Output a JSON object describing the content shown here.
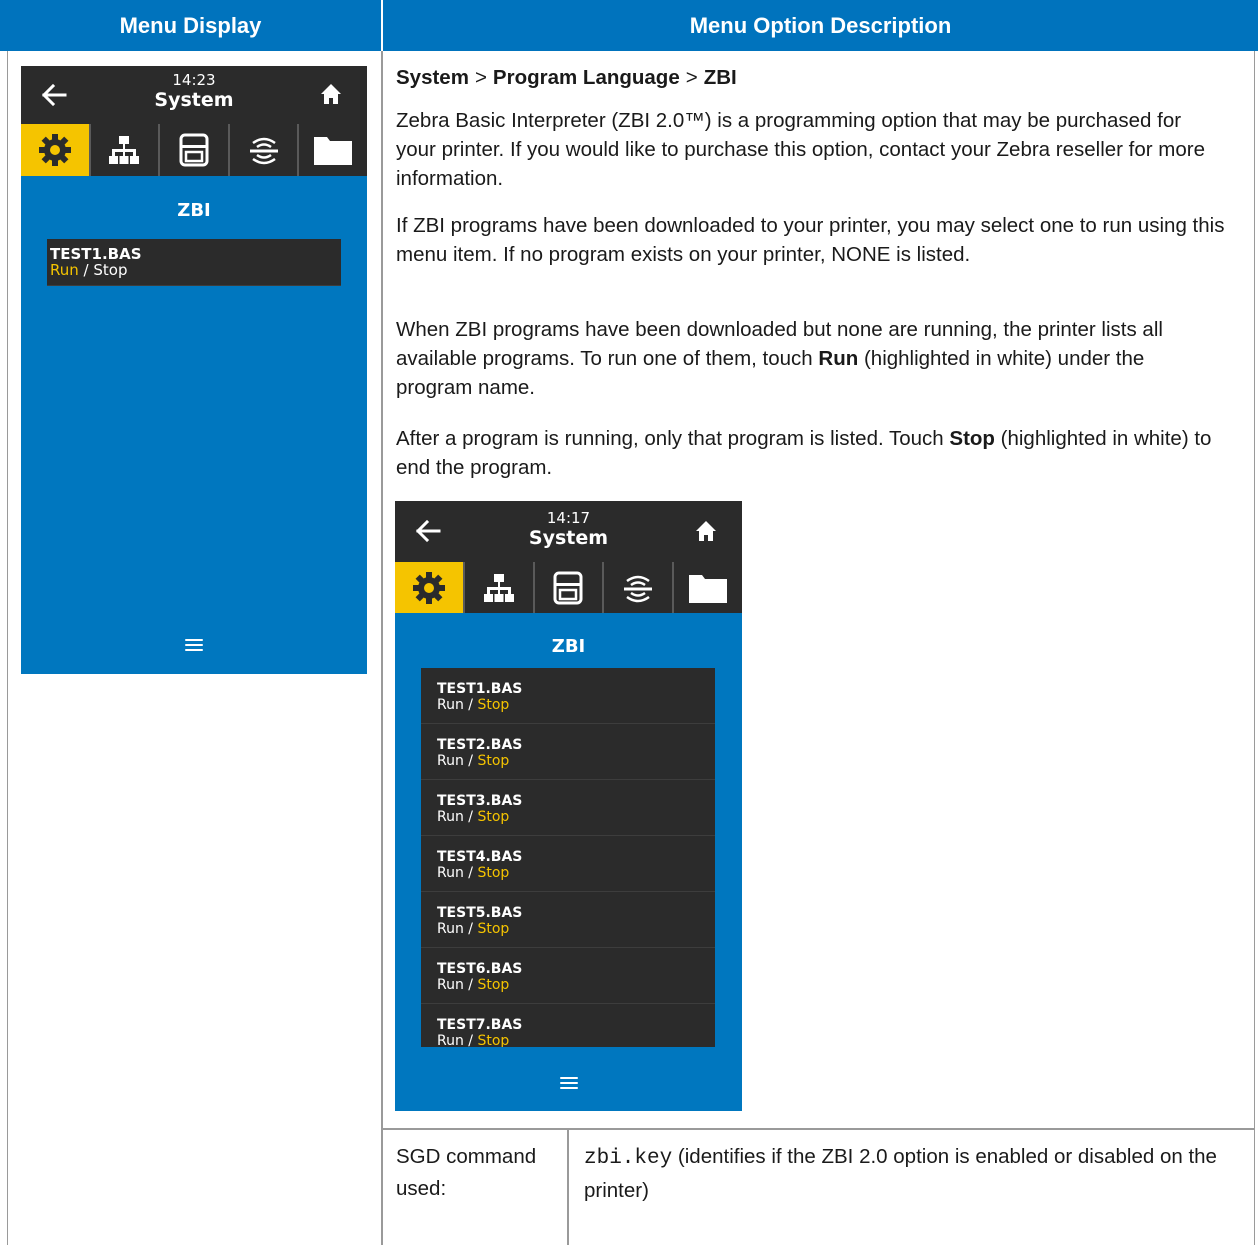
{
  "header": {
    "col1": "Menu Display",
    "col2": "Menu Option Description"
  },
  "breadcrumb": {
    "part1": "System",
    "sep1": ">",
    "part2": "Program Language",
    "sep2": ">",
    "part3": "ZBI"
  },
  "paragraphs": {
    "p1": "Zebra Basic Interpreter (ZBI 2.0™) is a programming option that may be purchased for your printer. If you would like to purchase this option, contact your Zebra reseller for more information.",
    "p2": "If ZBI programs have been downloaded to your printer, you may select one to run using this menu item. If no program exists on your printer, NONE is listed.",
    "p3_before": "When ZBI programs have been downloaded but none are running, the printer lists all available programs. To run one of them, touch ",
    "p3_bold": "Run",
    "p3_after": " (highlighted in white) under the program name.",
    "p4_before": "After a program is running, only that program is listed. Touch ",
    "p4_bold": "Stop",
    "p4_after": " (highlighted in white) to end the program."
  },
  "screen1": {
    "time": "14:23",
    "title": "System",
    "section": "ZBI",
    "programs": [
      {
        "name": "TEST1.BAS",
        "run": "Run",
        "slash": " / ",
        "stop": "Stop",
        "highlight": "run"
      }
    ]
  },
  "screen2": {
    "time": "14:17",
    "title": "System",
    "section": "ZBI",
    "programs": [
      {
        "name": "TEST1.BAS",
        "run": "Run",
        "slash": " / ",
        "stop": "Stop",
        "highlight": "stop"
      },
      {
        "name": "TEST2.BAS",
        "run": "Run",
        "slash": " / ",
        "stop": "Stop",
        "highlight": "stop"
      },
      {
        "name": "TEST3.BAS",
        "run": "Run",
        "slash": " / ",
        "stop": "Stop",
        "highlight": "stop"
      },
      {
        "name": "TEST4.BAS",
        "run": "Run",
        "slash": " / ",
        "stop": "Stop",
        "highlight": "stop"
      },
      {
        "name": "TEST5.BAS",
        "run": "Run",
        "slash": " / ",
        "stop": "Stop",
        "highlight": "stop"
      },
      {
        "name": "TEST6.BAS",
        "run": "Run",
        "slash": " / ",
        "stop": "Stop",
        "highlight": "stop"
      },
      {
        "name": "TEST7.BAS",
        "run": "Run",
        "slash": " / ",
        "stop": "Stop",
        "highlight": "stop"
      }
    ]
  },
  "icons": [
    "back-arrow-icon",
    "home-icon",
    "gear-icon",
    "network-icon",
    "printer-icon",
    "wireless-icon",
    "folder-icon",
    "menu-icon"
  ],
  "colors": {
    "header_blue": "#0073bd",
    "screen_blue": "#0077bf",
    "dark": "#2b2b2b",
    "accent_yellow": "#f5c400"
  },
  "sgd": {
    "label": "SGD command used:",
    "command": "zbi.key",
    "description": " (identifies if the ZBI 2.0 option is enabled or disabled on the printer)"
  }
}
